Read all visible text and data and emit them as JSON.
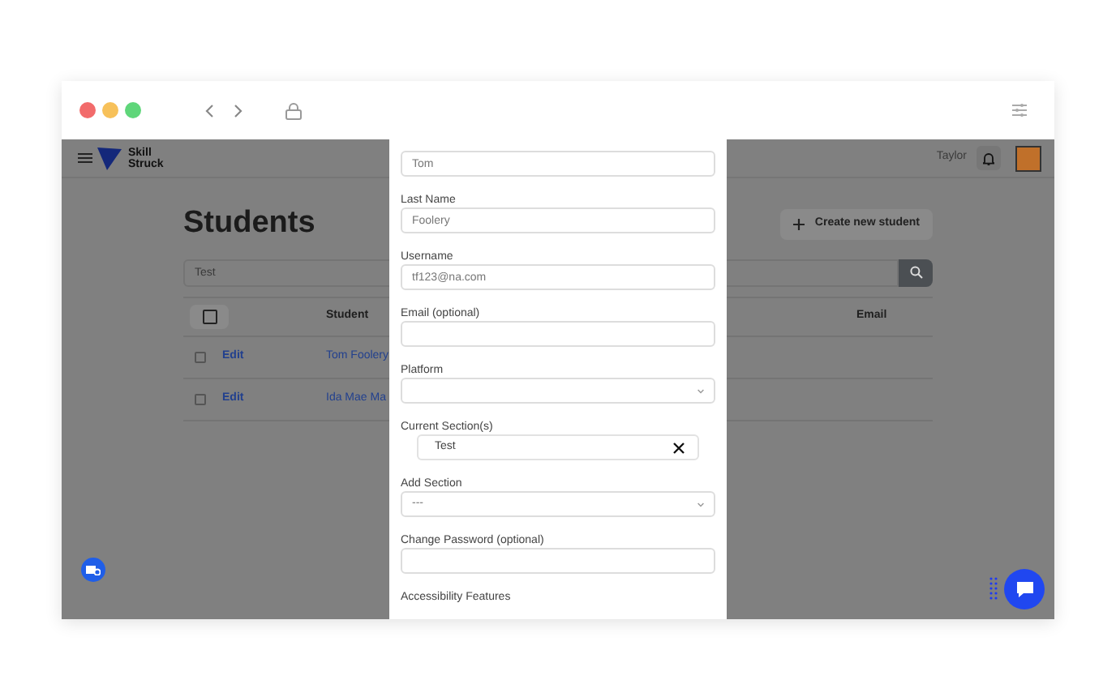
{
  "navbar": {
    "brand": "Skill Struck",
    "user_name": "Taylor"
  },
  "page": {
    "title": "Students",
    "create_button": "Create new student",
    "search": {
      "value": "Test"
    },
    "table": {
      "header_checkbox": {
        "checked": false
      },
      "columns": [
        "Student",
        "Email"
      ],
      "rows": [
        {
          "checked": false,
          "action": "Edit",
          "student": "Tom Foolery"
        },
        {
          "checked": false,
          "action": "Edit",
          "student": "Ida Mae Ma"
        }
      ]
    }
  },
  "modal": {
    "fields": [
      {
        "kind": "text",
        "value": "Tom"
      },
      {
        "kind": "text",
        "label": "Last Name",
        "value": "Foolery"
      },
      {
        "kind": "text",
        "label": "Username",
        "value": "tf123@na.com"
      },
      {
        "kind": "text",
        "label": "Email (optional)"
      },
      {
        "kind": "select",
        "label": "Platform"
      },
      {
        "kind": "chips",
        "label": "Current Section(s)",
        "chips": [
          {
            "label": "Test"
          }
        ]
      },
      {
        "kind": "select",
        "label": "Add Section",
        "value": "---"
      },
      {
        "kind": "text",
        "label": "Change Password (optional)"
      },
      {
        "kind": "heading",
        "label": "Accessibility Features"
      }
    ]
  }
}
